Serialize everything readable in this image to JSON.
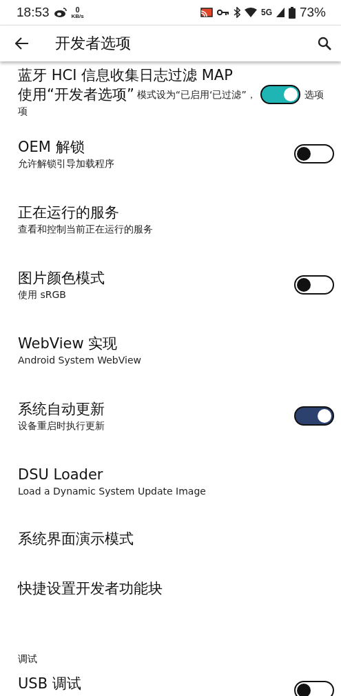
{
  "status_bar": {
    "time": "18:53",
    "net_speed_value": "0",
    "net_speed_unit": "KB/s",
    "network": "5G",
    "battery": "73%"
  },
  "app_bar": {
    "title": "开发者选项"
  },
  "items": [
    {
      "kind": "switch",
      "title": "蓝牙 HCI 信息收集日志过滤 MAP",
      "overlay_text": "使用“开发者选项”",
      "summary": "模式设为“已启用‘已过滤”，",
      "summary_tail": "选项",
      "summary_line2": "项",
      "on": true,
      "color": "#1fb5b5"
    },
    {
      "kind": "switch",
      "title": "OEM 解锁",
      "summary": "允许解锁引导加载程序",
      "on": false
    },
    {
      "kind": "plain",
      "title": "正在运行的服务",
      "summary": "查看和控制当前正在运行的服务"
    },
    {
      "kind": "switch",
      "title": "图片颜色模式",
      "summary": "使用 sRGB",
      "on": false
    },
    {
      "kind": "plain",
      "title": "WebView 实现",
      "summary": "Android System WebView"
    },
    {
      "kind": "switch",
      "title": "系统自动更新",
      "summary": "设备重启时执行更新",
      "on": true,
      "color": "#2d416e"
    },
    {
      "kind": "plain",
      "title": "DSU Loader",
      "summary": "Load a Dynamic System Update Image"
    },
    {
      "kind": "plain",
      "title": "系统界面演示模式"
    },
    {
      "kind": "plain",
      "title": "快捷设置开发者功能块"
    },
    {
      "kind": "category",
      "title": "调试"
    },
    {
      "kind": "switch",
      "title": "USB 调试",
      "on": false
    }
  ]
}
